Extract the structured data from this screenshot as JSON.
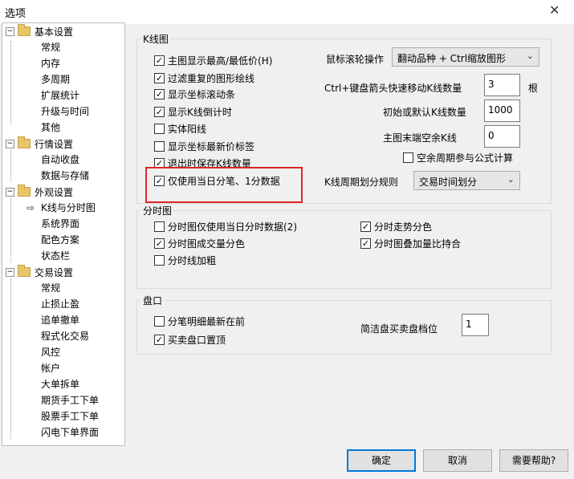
{
  "window": {
    "title": "选项",
    "close_glyph": "✕"
  },
  "tree": {
    "groups": [
      {
        "label": "基本设置",
        "items": [
          "常规",
          "内存",
          "多周期",
          "扩展统计",
          "升级与时间",
          "其他"
        ]
      },
      {
        "label": "行情设置",
        "items": [
          "自动收盘",
          "数据与存储"
        ]
      },
      {
        "label": "外观设置",
        "items": [
          "K线与分时图",
          "系统界面",
          "配色方案",
          "状态栏"
        ]
      },
      {
        "label": "交易设置",
        "items": [
          "常规",
          "止损止盈",
          "追单撤单",
          "程式化交易",
          "风控",
          "帐户",
          "大单拆单",
          "期货手工下单",
          "股票手工下单",
          "闪电下单界面"
        ]
      }
    ],
    "selected": "K线与分时图"
  },
  "kline": {
    "label": "K线图",
    "checkboxes": [
      {
        "label": "主图显示最高/最低价(H)",
        "checked": true
      },
      {
        "label": "过滤重复的图形绘线",
        "checked": true
      },
      {
        "label": "显示坐标滚动条",
        "checked": true
      },
      {
        "label": "显示K线倒计时",
        "checked": true
      },
      {
        "label": "实体阳线",
        "checked": false
      },
      {
        "label": "显示坐标最新价标签",
        "checked": false
      },
      {
        "label": "退出时保存K线数量",
        "checked": true
      },
      {
        "label": "仅使用当日分笔、1分数据",
        "checked": true
      }
    ],
    "scroll_label": "鼠标滚轮操作",
    "scroll_value": "翻动品种 + Ctrl缩放图形",
    "ctrl_label": "Ctrl+键盘箭头快速移动K线数量",
    "ctrl_value": "3",
    "ctrl_unit": "根",
    "init_label": "初始或默认K线数量",
    "init_value": "1000",
    "blank_label": "主图末端空余K线",
    "blank_value": "0",
    "blank_cycle": {
      "label": "空余周期参与公式计算",
      "checked": false
    },
    "period_label": "K线周期划分规则",
    "period_value": "交易时间划分"
  },
  "timeshare": {
    "label": "分时图",
    "checkboxes": [
      {
        "label": "分时图仅使用当日分时数据(2)",
        "checked": false
      },
      {
        "label": "分时走势分色",
        "checked": true
      },
      {
        "label": "分时图成交量分色",
        "checked": true
      },
      {
        "label": "分时图叠加量比持合",
        "checked": true
      },
      {
        "label": "分时线加粗",
        "checked": false
      }
    ]
  },
  "panel": {
    "label": "盘口",
    "checkboxes": [
      {
        "label": "分笔明细最新在前",
        "checked": false
      },
      {
        "label": "买卖盘口置顶",
        "checked": true
      }
    ],
    "level_label": "简洁盘买卖盘档位",
    "level_value": "1"
  },
  "buttons": {
    "ok": "确定",
    "cancel": "取消",
    "help": "需要帮助?"
  },
  "glyphs": {
    "check": "✓",
    "collapse": "−",
    "chevron": "⌄",
    "arrow": "⇨"
  },
  "icons": {
    "folder": "folder-icon",
    "close": "close-icon",
    "chevron": "chevron-down-icon",
    "arrow": "arrow-right-icon"
  },
  "colors": {
    "highlight": "#e02424",
    "primary_border": "#0078d7",
    "folder": "#e7c66a"
  }
}
